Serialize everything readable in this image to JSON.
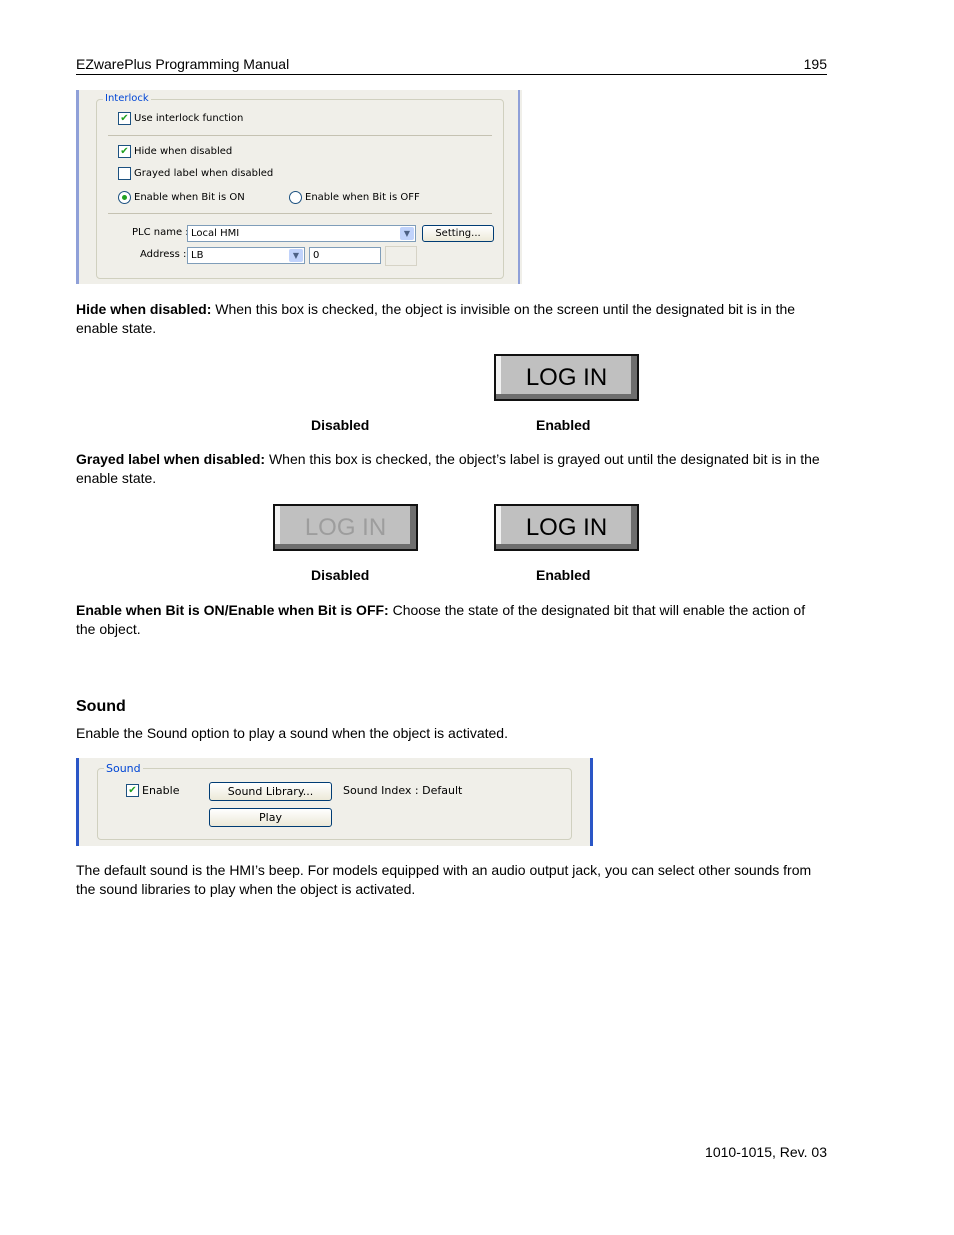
{
  "header": {
    "title": "EZwarePlus Programming Manual",
    "page_number": "195"
  },
  "interlock_dialog": {
    "group_label": "Interlock",
    "use_interlock": {
      "label": "Use interlock function",
      "checked": true
    },
    "hide_when_disabled": {
      "label": "Hide when disabled",
      "checked": true
    },
    "grayed_label": {
      "label": "Grayed label when disabled",
      "checked": false
    },
    "enable_on": {
      "label": "Enable when Bit is ON",
      "selected": true
    },
    "enable_off": {
      "label": "Enable when Bit is OFF",
      "selected": false
    },
    "plc_name_label": "PLC name :",
    "plc_name_value": "Local HMI",
    "setting_button": "Setting...",
    "address_label": "Address :",
    "address_type": "LB",
    "address_value": "0",
    "check_glyph": "✔",
    "dropdown_glyph": "▼"
  },
  "paragraphs": {
    "hide": {
      "bold": "Hide when disabled:",
      "text": " When this box is checked, the object is invisible on the screen until the designated bit is in the enable state."
    },
    "grayed": {
      "bold": "Grayed label when disabled:",
      "text": " When this box is checked, the object’s label is grayed out until the designated bit is in the enable state."
    },
    "enable": {
      "bold": "Enable when Bit is ON/Enable when Bit is OFF:",
      "text": " Choose the state of the designated bit that will enable the action of the object."
    },
    "sound_intro": "Enable the Sound option to play a sound when the object is activated.",
    "sound_default": "The default sound is the HMI’s beep. For models equipped with an audio output jack, you can select other sounds from the sound libraries to play when the object is activated."
  },
  "figures": {
    "hide": {
      "disabled_caption": "Disabled",
      "enabled_caption": "Enabled",
      "enabled_button": "LOG IN"
    },
    "grayed": {
      "disabled_caption": "Disabled",
      "enabled_caption": "Enabled",
      "disabled_button": "LOG IN",
      "enabled_button": "LOG IN"
    }
  },
  "sound_section": {
    "heading": "Sound"
  },
  "sound_dialog": {
    "group_label": "Sound",
    "enable": {
      "label": "Enable",
      "checked": true
    },
    "library_button": "Sound Library...",
    "play_button": "Play",
    "sound_index": "Sound Index : Default"
  },
  "footer": {
    "doc_id": "1010-1015, Rev. 03"
  }
}
